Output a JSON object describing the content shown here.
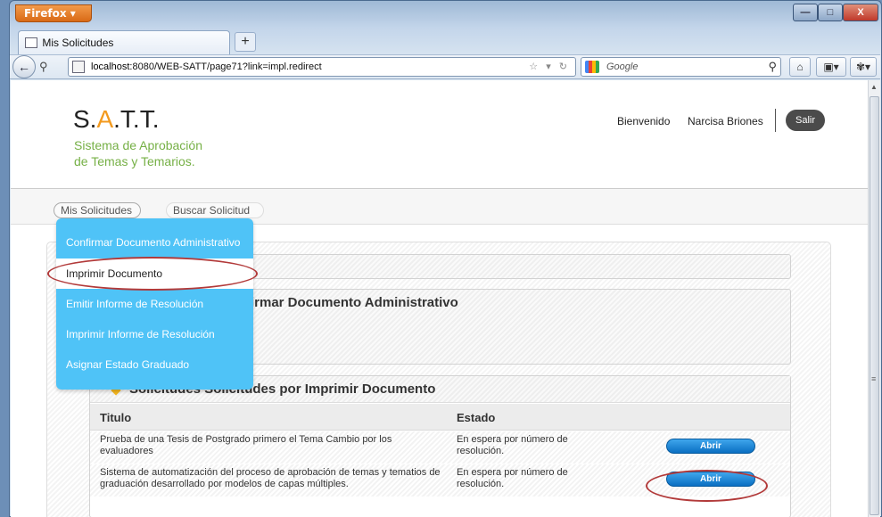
{
  "browser": {
    "menu_label": "Firefox ▾",
    "tab_title": "Mis Solicitudes",
    "new_tab": "+",
    "url_host": "localhost",
    "url_rest": ":8080/WEB-SATT/page71?link=impl.redirect",
    "search_placeholder": "Google",
    "window_controls": {
      "min": "—",
      "max": "□",
      "close": "X"
    }
  },
  "header": {
    "logo_pre": "S.",
    "logo_a": "A",
    "logo_post": ".T.T.",
    "subtitle_1": "Sistema de Aprobación",
    "subtitle_2": "de Temas y Temarios.",
    "welcome": "Bienvenido",
    "user_name": "Narcisa Briones",
    "logout": "Salir"
  },
  "nav": {
    "tab_1": "Mis Solicitudes",
    "tab_2": "Buscar Solicitud"
  },
  "menu": {
    "items": [
      "Confirmar Documento Administrativo",
      "Imprimir Documento",
      "Emitir Informe de Resolución",
      "Imprimir Informe de Resolución",
      "Asignar Estado Graduado"
    ]
  },
  "sections": {
    "confirm_title": "firmar Documento Administrativo",
    "print_title": "Solicitudes Solicitudes por Imprimir Documento"
  },
  "table": {
    "columns": [
      "Titulo",
      "Estado"
    ],
    "rows": [
      {
        "title": "Prueba de una Tesis de Postgrado primero el Tema Cambio por los evaluadores",
        "status": "En espera por número de resolución.",
        "action": "Abrir"
      },
      {
        "title": "Sistema de automatización del proceso de aprobación de temas y tematios de graduación desarrollado por modelos de capas múltiples.",
        "status": "En espera por número de resolución.",
        "action": "Abrir"
      }
    ]
  },
  "colors": {
    "menu_bg": "#4fc3f7",
    "logo_accent": "#f39a1e",
    "subtitle": "#76b046",
    "button_blue": "#0a6fc2",
    "annotation": "#b23a3a"
  }
}
